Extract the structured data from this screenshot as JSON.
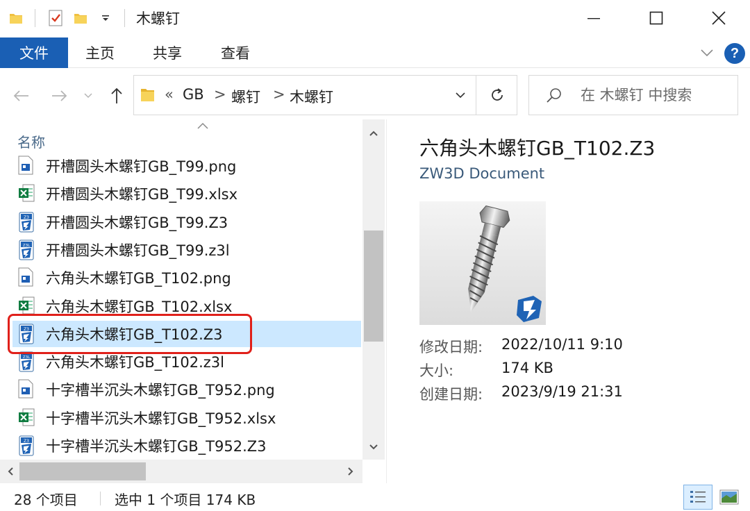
{
  "window": {
    "title": "木螺钉",
    "quick_access_icons": [
      "folder-icon",
      "properties-checklist-icon",
      "new-folder-icon",
      "customize-dropdown-icon"
    ],
    "controls": [
      "minimize-icon",
      "maximize-icon",
      "close-icon"
    ]
  },
  "ribbon": {
    "file_tab": "文件",
    "tabs": [
      "主页",
      "共享",
      "查看"
    ],
    "help_label": "?",
    "colors": {
      "file_tab_bg": "#1a5fb4",
      "selected_row_bg": "#cce8ff",
      "highlight_border": "#e0201a"
    }
  },
  "address": {
    "overflow": "«",
    "crumbs": [
      "GB",
      "螺钉",
      "木螺钉"
    ],
    "separator": ">",
    "search_placeholder": "在 木螺钉 中搜索"
  },
  "file_list": {
    "column_header": "名称",
    "items": [
      {
        "name": "开槽圆头木螺钉GB_T99.png",
        "icon": "png-image-icon"
      },
      {
        "name": "开槽圆头木螺钉GB_T99.xlsx",
        "icon": "excel-file-icon"
      },
      {
        "name": "开槽圆头木螺钉GB_T99.Z3",
        "icon": "zw3d-file-icon"
      },
      {
        "name": "开槽圆头木螺钉GB_T99.z3l",
        "icon": "zw3d-library-icon"
      },
      {
        "name": "六角头木螺钉GB_T102.png",
        "icon": "png-image-icon"
      },
      {
        "name": "六角头木螺钉GB_T102.xlsx",
        "icon": "excel-file-icon"
      },
      {
        "name": "六角头木螺钉GB_T102.Z3",
        "icon": "zw3d-file-icon",
        "selected": true
      },
      {
        "name": "六角头木螺钉GB_T102.z3l",
        "icon": "zw3d-library-icon"
      },
      {
        "name": "十字槽半沉头木螺钉GB_T952.png",
        "icon": "png-image-icon"
      },
      {
        "name": "十字槽半沉头木螺钉GB_T952.xlsx",
        "icon": "excel-file-icon"
      },
      {
        "name": "十字槽半沉头木螺钉GB_T952.Z3",
        "icon": "zw3d-file-icon"
      }
    ]
  },
  "preview": {
    "title": "六角头木螺钉GB_T102.Z3",
    "type": "ZW3D Document",
    "thumbnail": "hex-wood-screw-icon",
    "props": [
      {
        "label": "修改日期:",
        "value": "2022/10/11 9:10"
      },
      {
        "label": "大小:",
        "value": "174 KB"
      },
      {
        "label": "创建日期:",
        "value": "2023/9/19 21:31"
      }
    ]
  },
  "status": {
    "count": "28 个项目",
    "selection": "选中 1 个项目  174 KB",
    "view_icons": [
      "details-view-icon",
      "large-icons-view-icon"
    ]
  }
}
